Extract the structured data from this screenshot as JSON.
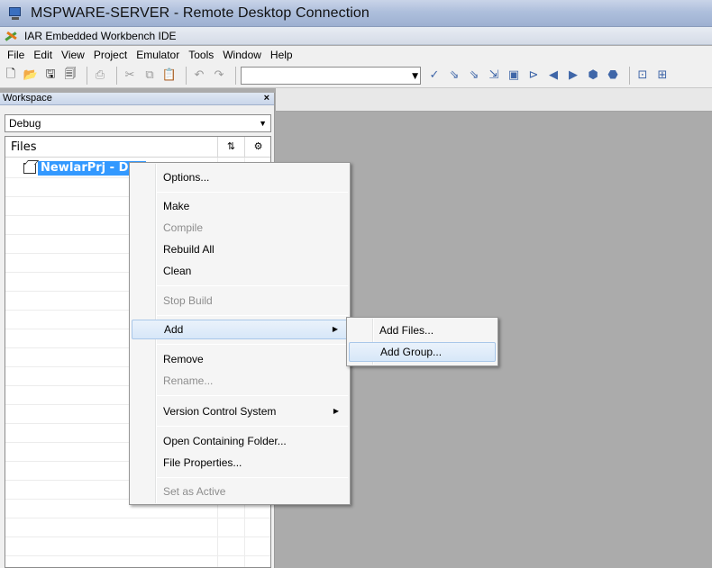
{
  "window": {
    "title": "MSPWARE-SERVER - Remote Desktop Connection",
    "icon": "remote-desktop-icon"
  },
  "app": {
    "title": "IAR Embedded Workbench IDE",
    "icon": "iar-icon"
  },
  "menubar": {
    "items": [
      "File",
      "Edit",
      "View",
      "Project",
      "Emulator",
      "Tools",
      "Window",
      "Help"
    ]
  },
  "toolbar": {
    "combo_value": "",
    "combo_arrow": "▼"
  },
  "workspace": {
    "title": "Workspace",
    "close": "×",
    "configuration": "Debug",
    "files_header": "Files",
    "project_label": "NewIarPrj - Debug"
  },
  "context_menu": {
    "options": "Options...",
    "make": "Make",
    "compile": "Compile",
    "rebuild_all": "Rebuild All",
    "clean": "Clean",
    "stop_build": "Stop Build",
    "add": "Add",
    "remove": "Remove",
    "rename": "Rename...",
    "version_control": "Version Control System",
    "open_containing_folder": "Open Containing Folder...",
    "file_properties": "File Properties...",
    "set_as_active": "Set as Active"
  },
  "add_submenu": {
    "add_files": "Add Files...",
    "add_group": "Add Group..."
  },
  "colors": {
    "selection": "#3399ff",
    "editor_bg": "#ababab",
    "menu_highlight_border": "#a9c7e9"
  }
}
